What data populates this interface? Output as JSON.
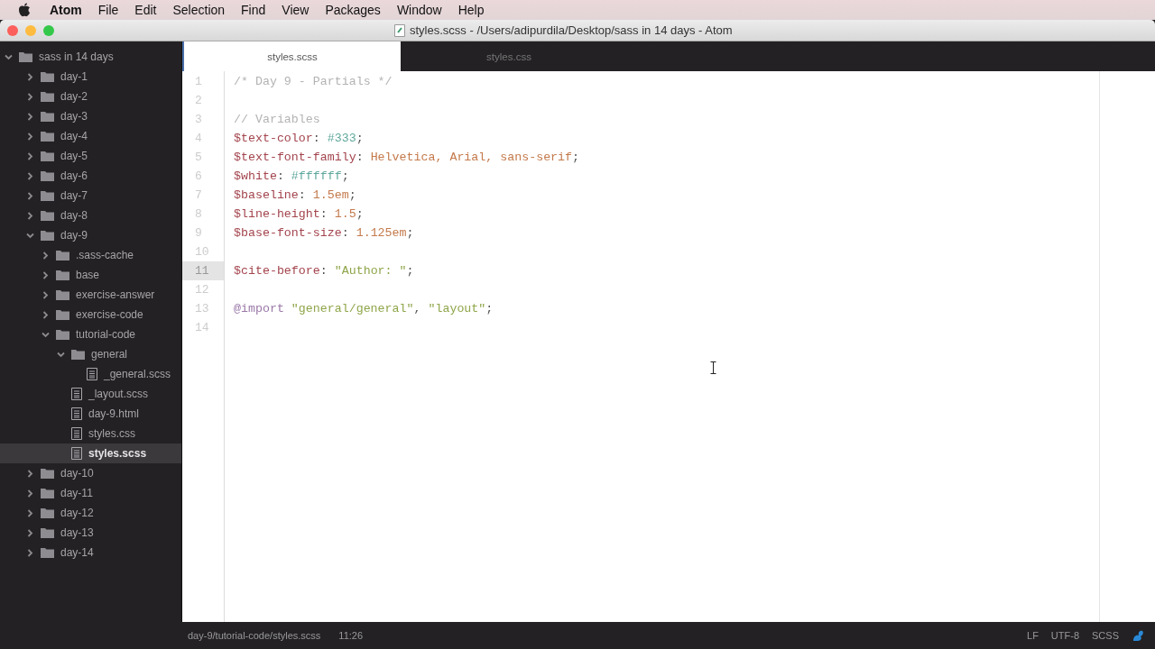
{
  "menu_bar": {
    "app_name": "Atom",
    "items": [
      "File",
      "Edit",
      "Selection",
      "Find",
      "View",
      "Packages",
      "Window",
      "Help"
    ]
  },
  "window": {
    "title": "styles.scss - /Users/adipurdila/Desktop/sass in 14 days - Atom"
  },
  "tree": {
    "root": {
      "label": "sass in 14 days",
      "expanded": true,
      "children": [
        {
          "kind": "folder",
          "label": "day-1",
          "expanded": false,
          "selected": false
        },
        {
          "kind": "folder",
          "label": "day-2",
          "expanded": false,
          "selected": false
        },
        {
          "kind": "folder",
          "label": "day-3",
          "expanded": false,
          "selected": false
        },
        {
          "kind": "folder",
          "label": "day-4",
          "expanded": false,
          "selected": false
        },
        {
          "kind": "folder",
          "label": "day-5",
          "expanded": false,
          "selected": false
        },
        {
          "kind": "folder",
          "label": "day-6",
          "expanded": false,
          "selected": false
        },
        {
          "kind": "folder",
          "label": "day-7",
          "expanded": false,
          "selected": false
        },
        {
          "kind": "folder",
          "label": "day-8",
          "expanded": false,
          "selected": false
        },
        {
          "kind": "folder",
          "label": "day-9",
          "expanded": true,
          "selected": false,
          "children": [
            {
              "kind": "folder",
              "label": ".sass-cache",
              "expanded": false,
              "selected": false
            },
            {
              "kind": "folder",
              "label": "base",
              "expanded": false,
              "selected": false
            },
            {
              "kind": "folder",
              "label": "exercise-answer",
              "expanded": false,
              "selected": false
            },
            {
              "kind": "folder",
              "label": "exercise-code",
              "expanded": false,
              "selected": false
            },
            {
              "kind": "folder",
              "label": "tutorial-code",
              "expanded": true,
              "selected": false,
              "children": [
                {
                  "kind": "folder",
                  "label": "general",
                  "expanded": true,
                  "selected": false,
                  "children": [
                    {
                      "kind": "file",
                      "label": "_general.scss",
                      "selected": false
                    }
                  ]
                },
                {
                  "kind": "file",
                  "label": "_layout.scss",
                  "selected": false
                },
                {
                  "kind": "file",
                  "label": "day-9.html",
                  "selected": false
                },
                {
                  "kind": "file",
                  "label": "styles.css",
                  "selected": false
                },
                {
                  "kind": "file",
                  "label": "styles.scss",
                  "selected": true
                }
              ]
            }
          ]
        },
        {
          "kind": "folder",
          "label": "day-10",
          "expanded": false,
          "selected": false
        },
        {
          "kind": "folder",
          "label": "day-11",
          "expanded": false,
          "selected": false
        },
        {
          "kind": "folder",
          "label": "day-12",
          "expanded": false,
          "selected": false
        },
        {
          "kind": "folder",
          "label": "day-13",
          "expanded": false,
          "selected": false
        },
        {
          "kind": "folder",
          "label": "day-14",
          "expanded": false,
          "selected": false
        }
      ]
    }
  },
  "tabs": [
    {
      "label": "styles.scss",
      "selected": true
    },
    {
      "label": "styles.css",
      "selected": false
    }
  ],
  "code_lines": [
    {
      "number": "1",
      "current": false,
      "tokens": [
        {
          "kind": "comment",
          "text": "/* Day 9 - Partials */"
        }
      ]
    },
    {
      "number": "2",
      "current": false
    },
    {
      "number": "3",
      "current": false,
      "tokens": [
        {
          "kind": "comment",
          "text": "// Variables"
        }
      ]
    },
    {
      "number": "4",
      "current": false,
      "tokens": [
        {
          "kind": "variable",
          "text": "$text-color"
        },
        {
          "kind": "punct",
          "text": ": "
        },
        {
          "kind": "hex",
          "text": "#333"
        },
        {
          "kind": "punct",
          "text": ";"
        }
      ]
    },
    {
      "number": "5",
      "current": false,
      "tokens": [
        {
          "kind": "variable",
          "text": "$text-font-family"
        },
        {
          "kind": "punct",
          "text": ": "
        },
        {
          "kind": "value",
          "text": "Helvetica, Arial, sans-serif"
        },
        {
          "kind": "punct",
          "text": ";"
        }
      ]
    },
    {
      "number": "6",
      "current": false,
      "tokens": [
        {
          "kind": "variable",
          "text": "$white"
        },
        {
          "kind": "punct",
          "text": ": "
        },
        {
          "kind": "hex",
          "text": "#ffffff"
        },
        {
          "kind": "punct",
          "text": ";"
        }
      ]
    },
    {
      "number": "7",
      "current": false,
      "tokens": [
        {
          "kind": "variable",
          "text": "$baseline"
        },
        {
          "kind": "punct",
          "text": ": "
        },
        {
          "kind": "value",
          "text": "1.5em"
        },
        {
          "kind": "punct",
          "text": ";"
        }
      ]
    },
    {
      "number": "8",
      "current": false,
      "tokens": [
        {
          "kind": "variable",
          "text": "$line-height"
        },
        {
          "kind": "punct",
          "text": ": "
        },
        {
          "kind": "value",
          "text": "1.5"
        },
        {
          "kind": "punct",
          "text": ";"
        }
      ]
    },
    {
      "number": "9",
      "current": false,
      "tokens": [
        {
          "kind": "variable",
          "text": "$base-font-size"
        },
        {
          "kind": "punct",
          "text": ": "
        },
        {
          "kind": "value",
          "text": "1.125em"
        },
        {
          "kind": "punct",
          "text": ";"
        }
      ]
    },
    {
      "number": "10",
      "current": false
    },
    {
      "number": "11",
      "current": true,
      "tokens": [
        {
          "kind": "variable",
          "text": "$cite-before"
        },
        {
          "kind": "punct",
          "text": ": "
        },
        {
          "kind": "string",
          "text": "\"Author: \""
        },
        {
          "kind": "punct",
          "text": ";"
        }
      ]
    },
    {
      "number": "12",
      "current": false
    },
    {
      "number": "13",
      "current": false,
      "tokens": [
        {
          "kind": "keyword",
          "text": "@import"
        },
        {
          "kind": "string",
          "text": " \"general/general\""
        },
        {
          "kind": "punct",
          "text": ", "
        },
        {
          "kind": "string",
          "text": "\"layout\""
        },
        {
          "kind": "punct",
          "text": ";"
        }
      ]
    },
    {
      "number": "14",
      "current": false
    }
  ],
  "status_bar": {
    "path": "day-9/tutorial-code/styles.scss",
    "cursor": "11:26",
    "line_ending": "LF",
    "encoding": "UTF-8",
    "grammar": "SCSS"
  }
}
